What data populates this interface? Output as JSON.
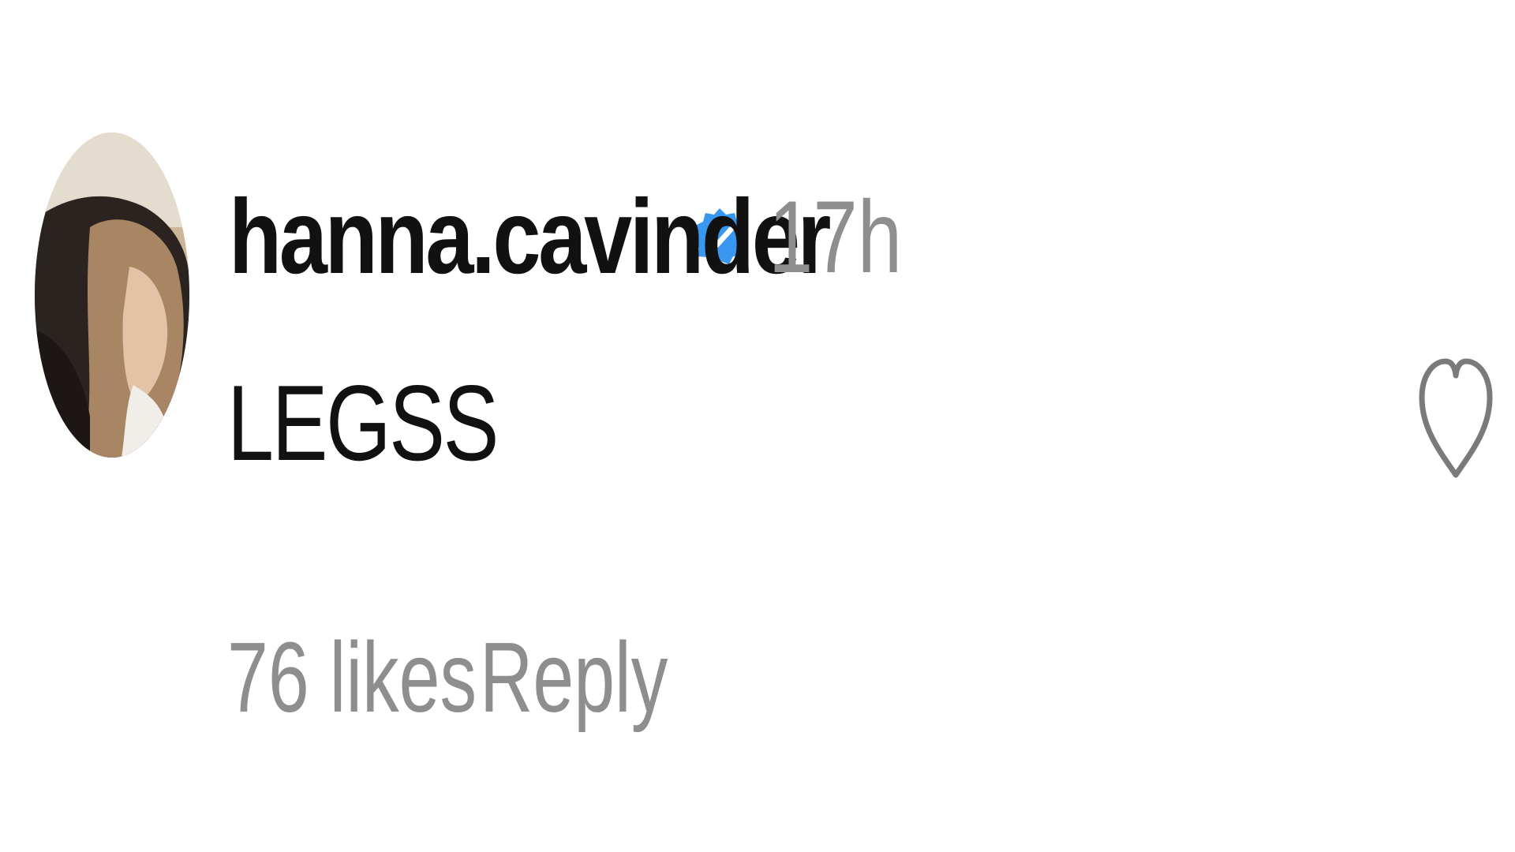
{
  "comment": {
    "username": "hanna.cavinder",
    "timestamp": "17h",
    "text": "LEGSS",
    "likes_label": "76 likes",
    "reply_label": "Reply"
  },
  "icons": {
    "verified": "verified-badge-icon",
    "like": "heart-outline-icon"
  },
  "colors": {
    "username": "#111111",
    "meta": "#8e8e8e",
    "verified": "#3897f0",
    "heart_stroke": "#7a7a7a"
  }
}
